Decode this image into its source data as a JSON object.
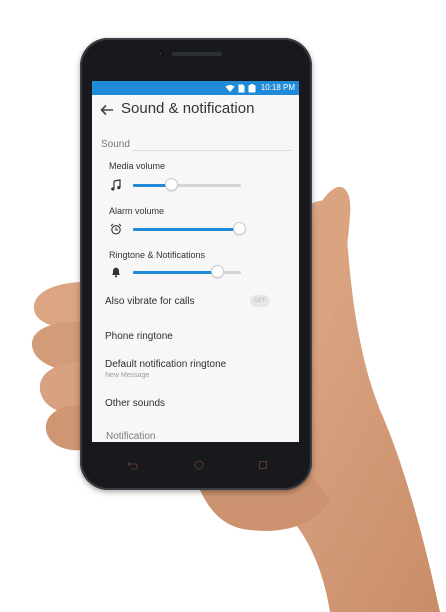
{
  "status_bar": {
    "time": "10:18 PM",
    "icons": [
      "wifi-icon",
      "sim-icon",
      "battery-icon"
    ]
  },
  "header": {
    "title": "Sound & notification"
  },
  "sound_section": {
    "heading": "Sound",
    "sliders": [
      {
        "label": "Media volume",
        "icon": "music-note-icon",
        "level": 0.35
      },
      {
        "label": "Alarm volume",
        "icon": "alarm-clock-icon",
        "level": 0.98
      },
      {
        "label": "Ringtone & Notifications",
        "icon": "bell-icon",
        "level": 0.78
      }
    ]
  },
  "settings": {
    "vibrate_label": "Also vibrate for calls",
    "vibrate_toggle": "OFF",
    "phone_ringtone": "Phone ringtone",
    "default_notification": "Default notification ringtone",
    "default_notification_value": "New Message",
    "other_sounds": "Other sounds"
  },
  "notification_section": {
    "heading": "Notification"
  },
  "nav_bar": {
    "buttons": [
      "back-icon",
      "home-icon",
      "recents-icon"
    ]
  },
  "colors": {
    "accent": "#1f8ad8",
    "phone_body": "#17191d",
    "skin": "#d9a47f"
  }
}
